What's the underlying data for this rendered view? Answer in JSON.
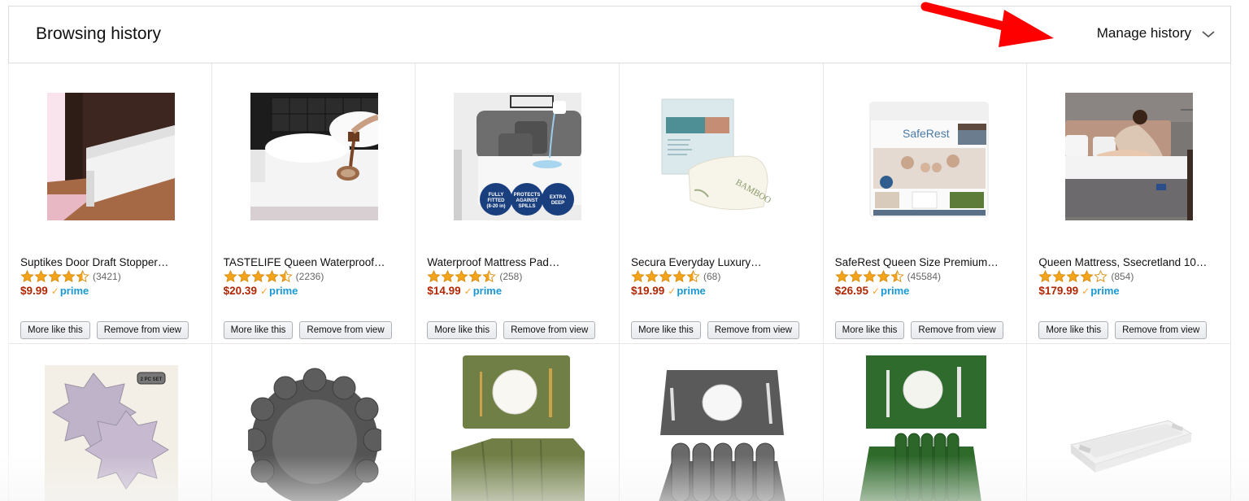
{
  "header": {
    "title": "Browsing history",
    "manage_label": "Manage history",
    "chevron_icon": "chevron-down-icon"
  },
  "annotation": {
    "arrow_icon": "red-arrow-pointing-to-manage-history",
    "color": "#ff0000"
  },
  "colors": {
    "price": "#b12704",
    "prime": "#1a98d5",
    "prime_check": "#f7a531",
    "star": "#f4a41c"
  },
  "buttons": {
    "more_like_this": "More like this",
    "remove_from_view": "Remove from view"
  },
  "prime_label": "prime",
  "prime_check": "✓",
  "products_row1": [
    {
      "name": "Suptikes Door Draft Stopper…",
      "rating": 4.5,
      "count": "(3421)",
      "price": "$9.99",
      "image": "door-draft-stopper-image"
    },
    {
      "name": "TASTELIFE Queen Waterproof…",
      "rating": 4.5,
      "count": "(2236)",
      "price": "$20.39",
      "image": "waterproof-mattress-protector-image"
    },
    {
      "name": "Waterproof Mattress Pad…",
      "rating": 4.5,
      "count": "(258)",
      "price": "$14.99",
      "image": "mattress-pad-image"
    },
    {
      "name": "Secura Everyday Luxury…",
      "rating": 4.5,
      "count": "(68)",
      "price": "$19.99",
      "image": "bamboo-mattress-protector-image"
    },
    {
      "name": "SafeRest Queen Size Premium…",
      "rating": 4.5,
      "count": "(45584)",
      "price": "$26.95",
      "image": "saferest-mattress-protector-image"
    },
    {
      "name": "Queen Mattress, Ssecretland 10…",
      "rating": 4,
      "count": "(854)",
      "price": "$179.99",
      "image": "queen-mattress-image"
    }
  ],
  "products_row2": [
    {
      "image": "lavender-flower-placemats-image",
      "badge": "2 PC SET"
    },
    {
      "image": "gray-round-placemat-image"
    },
    {
      "image": "olive-green-placemats-image"
    },
    {
      "image": "gray-woven-placemats-image"
    },
    {
      "image": "green-woven-placemats-image"
    },
    {
      "image": "white-serving-tray-image"
    }
  ]
}
